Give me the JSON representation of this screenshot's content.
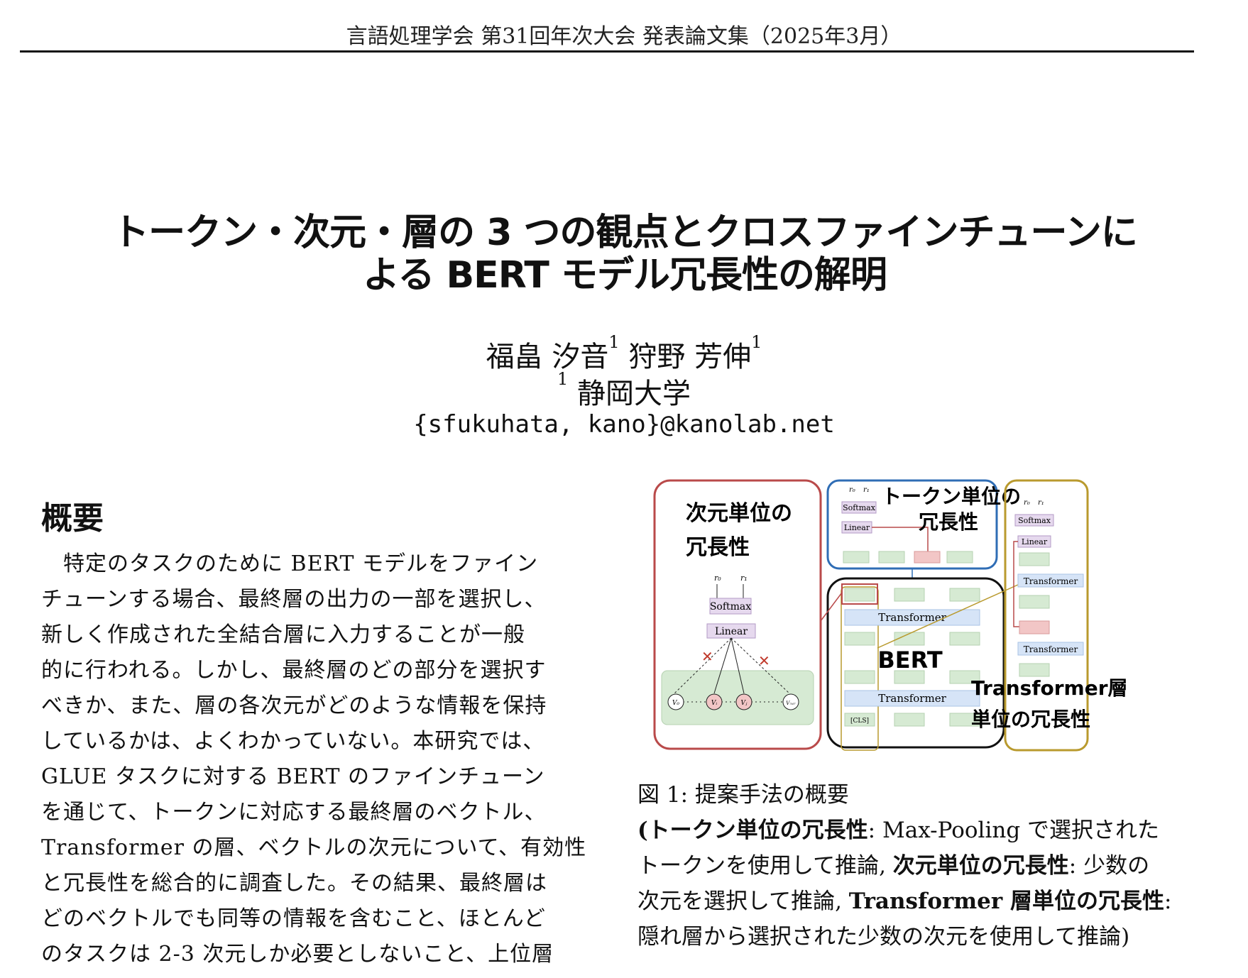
{
  "header": {
    "text": "言語処理学会 第31回年次大会 発表論文集（2025年3月）"
  },
  "title": {
    "line1": "トークン・次元・層の 3 つの観点とクロスファインチューンに",
    "line2": "よる BERT モデル冗長性の解明"
  },
  "authors": {
    "name1": "福畠 汐音",
    "sup1": "1",
    "name2": "狩野 芳伸",
    "sup2": "1"
  },
  "affiliation": {
    "sup": "1",
    "name": "静岡大学"
  },
  "email": "{sfukuhata, kano}@kanolab.net",
  "abstract": {
    "heading": "概要",
    "lines": [
      "　特定のタスクのために BERT モデルをファイン",
      "チューンする場合、最終層の出力の一部を選択し、",
      "新しく作成された全結合層に入力することが一般",
      "的に行われる。しかし、最終層のどの部分を選択す",
      "べきか、また、層の各次元がどのような情報を保持",
      "しているかは、よくわかっていない。本研究では、",
      "GLUE タスクに対する BERT のファインチューン",
      "を通じて、トークンに対応する最終層のベクトル、",
      "Transformer の層、ベクトルの次元について、有効性",
      "と冗長性を総合的に調査した。その結果、最終層は",
      "どのベクトルでも同等の情報を含むこと、ほとんど",
      "のタスクは 2-3 次元しか必要としないこと、上位層"
    ]
  },
  "figure": {
    "panel_dim_title1": "次元単位の",
    "panel_dim_title2": "冗長性",
    "panel_token_title1": "トークン単位の",
    "panel_token_title2": "冗長性",
    "panel_layer_title1": "Transformer層",
    "panel_layer_title2": "単位の冗長性",
    "bert_label": "BERT",
    "softmax": "Softmax",
    "linear": "Linear",
    "transformer": "Transformer",
    "cls": "[CLS]",
    "r0": "r₀",
    "r1": "r₁",
    "v0": "V₀",
    "vi": "Vᵢ",
    "vj": "Vⱼ",
    "v767": "V₇₆₇",
    "colors": {
      "red": "#b94a4a",
      "blue": "#2f6db5",
      "gold": "#b99a2e",
      "green": "#d6ead3",
      "purple": "#e6d9ee",
      "lightblue": "#d6e4f7",
      "pink": "#f2c6c6"
    }
  },
  "caption": {
    "line1": "図 1: 提案手法の概要",
    "line2_b1": "(トークン単位の冗長性",
    "line2_rest": ": Max-Pooling で選択された",
    "line3_a": "トークンを使用して推論, ",
    "line3_b": "次元単位の冗長性",
    "line3_c": ": 少数の",
    "line4_a": "次元を選択して推論, ",
    "line4_b": "Transformer 層単位の冗長性",
    "line4_c": ":",
    "line5": "隠れ層から選択された少数の次元を使用して推論)"
  }
}
